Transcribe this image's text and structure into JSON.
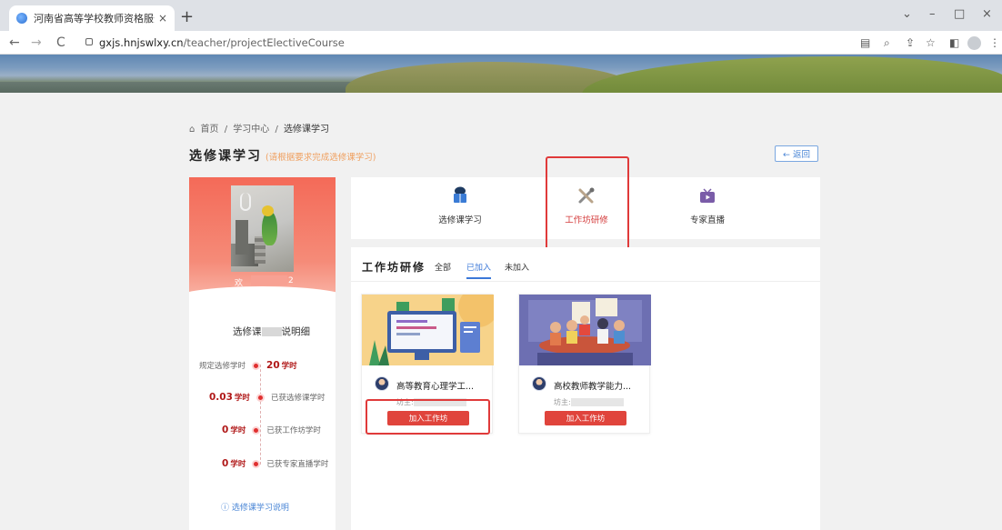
{
  "browser": {
    "tab_title": "河南省高等学校教师资格服务云",
    "tab_close": "×",
    "new_tab": "+",
    "url_host": "gxjs.hnjswlxy.cn",
    "url_path": "/teacher/projectElectiveCourse",
    "controls": {
      "minimize": "–",
      "restore": "□",
      "close": "×",
      "dropdown": "⌄"
    },
    "nav": {
      "back": "←",
      "forward": "→",
      "reload": "C"
    }
  },
  "breadcrumb": {
    "home": "首页",
    "sep": "/",
    "learning_center": "学习中心",
    "current": "选修课学习"
  },
  "page": {
    "title": "选修课学习",
    "subtitle": "(请根据要求完成选修课学习)",
    "back_label": "← 返回"
  },
  "profile": {
    "welcome": "欢",
    "welcome_suffix": "2"
  },
  "detail": {
    "title_prefix": "选修课",
    "title_suffix": "说明细",
    "required": {
      "label": "规定选修学时",
      "value": "20",
      "unit": "学时"
    },
    "rows": [
      {
        "value": "0.03",
        "unit": "学时",
        "label": "已获选修课学时"
      },
      {
        "value": "0",
        "unit": "学时",
        "label": "已获工作坊学时"
      },
      {
        "value": "0",
        "unit": "学时",
        "label": "已获专家直播学时"
      }
    ],
    "explain_link": "ⓘ 选修课学习说明"
  },
  "categories": [
    {
      "label": "选修课学习",
      "icon": "book-icon"
    },
    {
      "label": "工作坊研修",
      "icon": "tools-icon"
    },
    {
      "label": "专家直播",
      "icon": "tv-icon"
    }
  ],
  "workshop_section": {
    "title": "工作坊研修",
    "filters": [
      "全部",
      "已加入",
      "未加入"
    ],
    "active_filter": "已加入"
  },
  "workshops": [
    {
      "name": "高等教育心理学工...",
      "owner_prefix": "坊主:",
      "button": "加入工作坊"
    },
    {
      "name": "高校教师教学能力...",
      "owner_prefix": "坊主:",
      "button": "加入工作坊"
    }
  ],
  "colors": {
    "accent_red": "#e0443c",
    "link_blue": "#3b78d8",
    "annotation_red": "#e03a3a"
  }
}
